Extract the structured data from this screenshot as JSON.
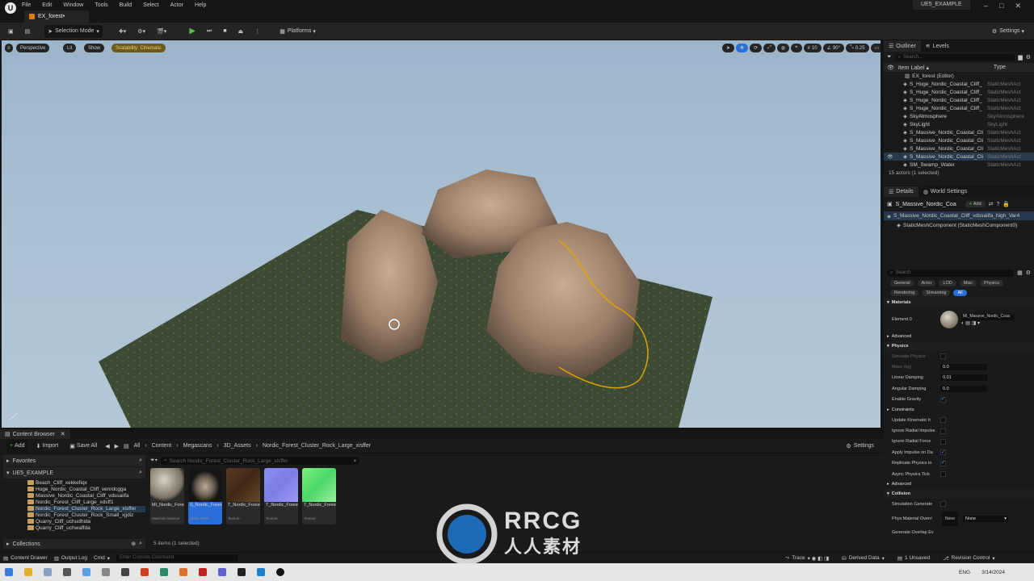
{
  "app": {
    "logo_glyph": "U",
    "menu": [
      "File",
      "Edit",
      "Window",
      "Tools",
      "Build",
      "Select",
      "Actor",
      "Help"
    ],
    "tab_title": "EX_forest•",
    "project_name": "UE5_EXAMPLE",
    "window_controls": [
      "–",
      "□",
      "✕"
    ]
  },
  "toolbar": {
    "selection_mode": "Selection Mode",
    "platforms": "Platforms",
    "settings": "Settings"
  },
  "viewport": {
    "perspective": "Perspective",
    "lit": "Lit",
    "show": "Show",
    "scalability": "Scalability: Cinematic",
    "grid_snap": "10",
    "rotation_snap": "90°",
    "scale_snap": "0.25",
    "camera_speed": "2",
    "colors": {
      "sky_top": "#9db5ca",
      "water": "#3a4a34",
      "selection_outline": "#e0a400"
    }
  },
  "outliner": {
    "tab": "Outliner",
    "levels_tab": "Levels",
    "search_placeholder": "Search...",
    "col_label": "Item Label ▴",
    "col_type": "Type",
    "root": "EX_forest (Editor)",
    "rows": [
      {
        "label": "S_Huge_Nordic_Coastal_Cliff_",
        "type": "StaticMeshAct"
      },
      {
        "label": "S_Huge_Nordic_Coastal_Cliff_",
        "type": "StaticMeshAct"
      },
      {
        "label": "S_Huge_Nordic_Coastal_Cliff_",
        "type": "StaticMeshAct"
      },
      {
        "label": "S_Huge_Nordic_Coastal_Cliff_",
        "type": "StaticMeshAct"
      },
      {
        "label": "SkyAtmosphere",
        "type": "SkyAtmosphere"
      },
      {
        "label": "SkyLight",
        "type": "SkyLight"
      },
      {
        "label": "S_Massive_Nordic_Coastal_Cli",
        "type": "StaticMeshAct"
      },
      {
        "label": "S_Massive_Nordic_Coastal_Cli",
        "type": "StaticMeshAct"
      },
      {
        "label": "S_Massive_Nordic_Coastal_Cli",
        "type": "StaticMeshAct"
      },
      {
        "label": "S_Massive_Nordic_Coastal_Cli",
        "type": "StaticMeshAct",
        "selected": true
      },
      {
        "label": "SM_Swamp_Water",
        "type": "StaticMeshAct"
      }
    ],
    "footer": "15 actors (1 selected)"
  },
  "details": {
    "tab": "Details",
    "world_tab": "World Settings",
    "actor_name": "S_Massive_Nordic_Coa",
    "add_label": "Add",
    "component_root": "S_Massive_Nordic_Coastal_Cliff_vdssaiifa_high_Var4",
    "component_child": "StaticMeshComponent (StaticMeshComponent0)",
    "search_placeholder": "Search",
    "filters_row1": [
      "General",
      "Actor",
      "LOD",
      "Misc",
      "Physics"
    ],
    "filters_row2": [
      "Rendering",
      "Streaming",
      "All"
    ],
    "materials_header": "Materials",
    "element_label": "Element 0",
    "material_name": "MI_Massive_Nordic_Coas",
    "advanced": "Advanced",
    "physics_header": "Physics",
    "physics_rows": [
      {
        "label": "Simulate Physics",
        "kind": "check",
        "value": "",
        "dim": true
      },
      {
        "label": "Mass (kg)",
        "kind": "num",
        "value": "0.0",
        "dim": true
      },
      {
        "label": "Linear Damping",
        "kind": "num",
        "value": "0.01"
      },
      {
        "label": "Angular Damping",
        "kind": "num",
        "value": "0.0"
      },
      {
        "label": "Enable Gravity",
        "kind": "check",
        "value": "✓"
      }
    ],
    "constraints": "Constraints",
    "constraint_rows": [
      {
        "label": "Update Kinematic fr",
        "value": ""
      },
      {
        "label": "Ignore Radial Impulse",
        "value": ""
      },
      {
        "label": "Ignore Radial Force",
        "value": ""
      },
      {
        "label": "Apply Impulse on Da",
        "value": "✓"
      },
      {
        "label": "Replicate Physics to",
        "value": "✓"
      },
      {
        "label": "Async Physics Tick",
        "value": ""
      }
    ],
    "advanced2": "Advanced",
    "collision_header": "Collision",
    "collision_rows": [
      {
        "label": "Simulation Generate",
        "value": ""
      }
    ],
    "phys_material_label": "Phys Material Overri",
    "phys_material_value": "None",
    "phys_material_thumb": "None",
    "generate_overlap": "Generate Overlap Ev"
  },
  "content_browser": {
    "tab": "Content Browser",
    "add": "Add",
    "import": "Import",
    "save_all": "Save All",
    "path": [
      "All",
      "Content",
      "Megascans",
      "3D_Assets",
      "Nordic_Forest_Cluster_Rock_Large_xisffer"
    ],
    "settings": "Settings",
    "favorites": "Favorites",
    "project": "UE5_EXAMPLE",
    "search_placeholder": "Search Nordic_Forest_Cluster_Rock_Large_xisffer",
    "folders": [
      {
        "name": "Beach_Cliff_xekkefiqx"
      },
      {
        "name": "Huge_Nordic_Coastal_Cliff_venrdcgga"
      },
      {
        "name": "Massive_Nordic_Coastal_Cliff_vdssaiifa"
      },
      {
        "name": "Nordic_Forest_Cliff_Large_xdsff1"
      },
      {
        "name": "Nordic_Forest_Cluster_Rock_Large_xisffer",
        "selected": true
      },
      {
        "name": "Nordic_Forest_Cluster_Rock_Small_xjjdiz"
      },
      {
        "name": "Quarry_Cliff_uchudhida"
      },
      {
        "name": "Quarry_Cliff_uchwaffda"
      }
    ],
    "assets": [
      {
        "name": "MI_Nordic_Forest_Clust...",
        "type": "Material Instance",
        "thumb": "sphere"
      },
      {
        "name": "S_Nordic_Forest_Clust...",
        "type": "Static Mesh",
        "thumb": "rock",
        "selected": true
      },
      {
        "name": "T_Nordic_Forest_Clust...",
        "type": "Texture",
        "thumb": "brown"
      },
      {
        "name": "T_Nordic_Forest_Clust...",
        "type": "Texture",
        "thumb": "purple"
      },
      {
        "name": "T_Nordic_ForestClust...",
        "type": "Texture",
        "thumb": "green"
      }
    ],
    "collections": "Collections",
    "count": "5 items (1 selected)"
  },
  "status": {
    "content_drawer": "Content Drawer",
    "output_log": "Output Log",
    "cmd": "Cmd",
    "console_placeholder": "Enter Console Command",
    "trace": "Trace",
    "derived_data": "Derived Data",
    "unsaved": "1 Unsaved",
    "revision": "Revision Control"
  },
  "taskbar": {
    "lang": "ENG",
    "date": "3/14/2024"
  }
}
